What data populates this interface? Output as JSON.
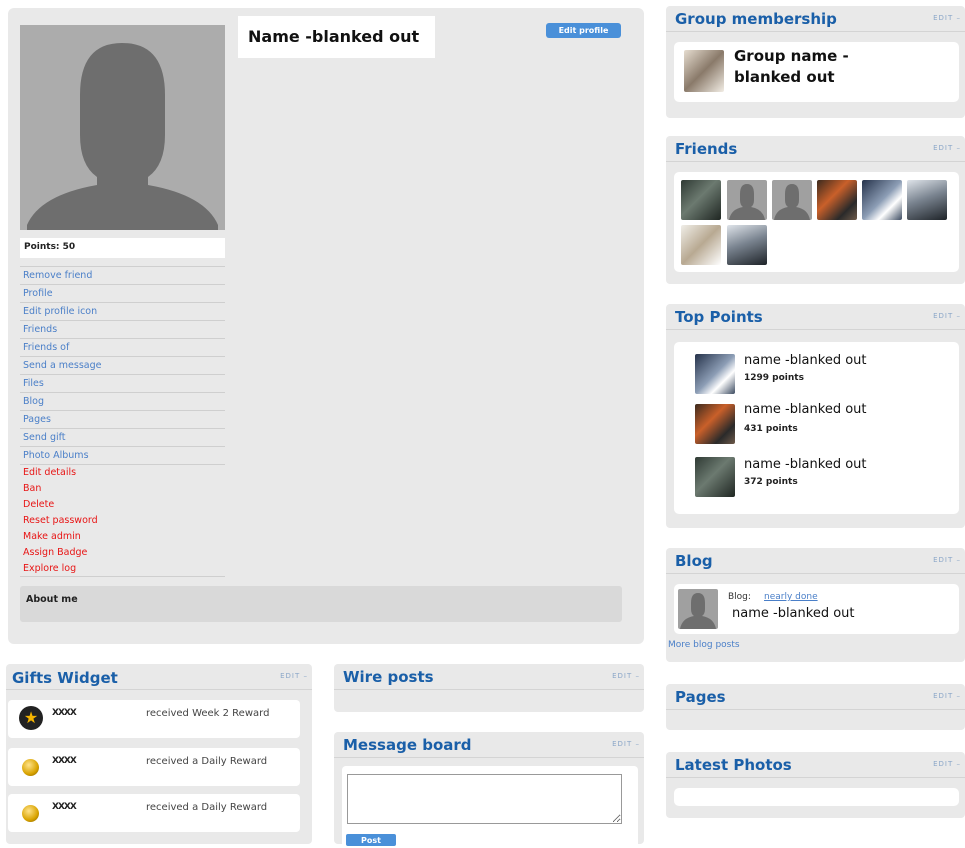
{
  "profile": {
    "name": "Name -blanked out",
    "edit_profile_label": "Edit profile",
    "points_label": "Points: 50",
    "about_label": "About me",
    "menu_items": [
      "Remove friend",
      "Profile",
      "Edit profile icon",
      "Friends",
      "Friends of",
      "Send a message",
      "Files",
      "Blog",
      "Pages",
      "Send gift",
      "Photo Albums"
    ],
    "admin_items": [
      "Edit details",
      "Ban",
      "Delete",
      "Reset password",
      "Make admin",
      "Assign Badge",
      "Explore log"
    ],
    "admin_color": "#e81515",
    "link_color": "#4a7fc8"
  },
  "edit_label": "EDIT",
  "group_membership": {
    "title": "Group membership",
    "group_name": "Group name - blanked out"
  },
  "friends": {
    "title": "Friends",
    "thumbs": [
      "photo",
      "default-avatar",
      "default-avatar",
      "photo",
      "photo",
      "photo",
      "photo",
      "photo"
    ]
  },
  "top_points": {
    "title": "Top Points",
    "entries": [
      {
        "name": "name -blanked out",
        "points": "1299 points"
      },
      {
        "name": "name -blanked out",
        "points": "431 points"
      },
      {
        "name": "name -blanked out",
        "points": "372 points"
      }
    ]
  },
  "blog": {
    "title": "Blog",
    "prefix": "Blog:",
    "post_link": "nearly done",
    "author": "name -blanked out",
    "more_link": "More blog posts"
  },
  "pages": {
    "title": "Pages"
  },
  "latest_photos": {
    "title": "Latest Photos"
  },
  "gifts": {
    "title": "Gifts Widget",
    "items": [
      {
        "user": "XXXX",
        "text": "received Week 2 Reward",
        "icon": "star-badge-icon"
      },
      {
        "user": "XXXX",
        "text": "received a Daily Reward",
        "icon": "coin-icon"
      },
      {
        "user": "XXXX",
        "text": "received a Daily Reward",
        "icon": "coin-icon"
      }
    ]
  },
  "wire_posts": {
    "title": "Wire posts"
  },
  "message_board": {
    "title": "Message board",
    "post_label": "Post"
  },
  "colors": {
    "widget_title": "#1a5fa8",
    "panel_bg": "#e9e9e9",
    "button_blue": "#4a90d9"
  }
}
